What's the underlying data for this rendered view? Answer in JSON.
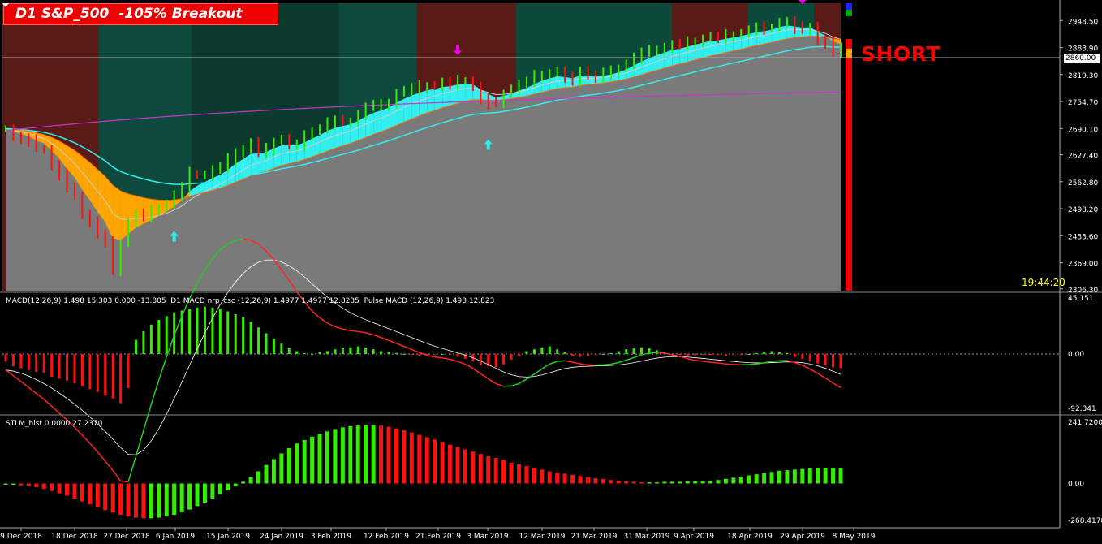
{
  "title": "D1 S&P_500  -105% Breakout",
  "signal": "SHORT",
  "clock": "19:44:20",
  "current_price": "2860.00",
  "macd_label": "MACD(12,26,9) 1.498 15.303 0.000 -13.805  D1 MACD nrp_csc (12,26,9) 1.4977 1.4977 12.8235  Pulse MACD (12,26,9) 1.498 12.823",
  "stlm_label": "STLM_hist 0.0000 27.2370",
  "colors": {
    "up": "#33ee00",
    "down": "#ff1010",
    "cyan": "#33eeee",
    "orange": "#ffa500",
    "magenta": "#ee00ee",
    "gray_fill": "#7a7a7a",
    "bg_green": "#0b4a3a",
    "bg_red": "#5a1a18"
  },
  "chart_data": [
    {
      "type": "bar",
      "name": "price",
      "ylim": [
        2300,
        2990
      ],
      "y_ticks": [
        "2948.50",
        "2883.90",
        "2819.30",
        "2754.70",
        "2690.10",
        "2627.40",
        "2562.80",
        "2498.20",
        "2433.60",
        "2369.00",
        "2306.30"
      ],
      "y_tick_values": [
        2948.5,
        2883.9,
        2819.3,
        2754.7,
        2690.1,
        2627.4,
        2562.8,
        2498.2,
        2433.6,
        2369.0,
        2306.3
      ],
      "x_ticks": [
        "9 Dec 2018",
        "18 Dec 2018",
        "27 Dec 2018",
        "6 Jan 2019",
        "15 Jan 2019",
        "24 Jan 2019",
        "3 Feb 2019",
        "12 Feb 2019",
        "21 Feb 2019",
        "3 Mar 2019",
        "12 Mar 2019",
        "21 Mar 2019",
        "31 Mar 2019",
        "9 Apr 2019",
        "18 Apr 2019",
        "29 Apr 2019",
        "8 May 2019"
      ],
      "closes": [
        2690,
        2670,
        2665,
        2660,
        2642,
        2640,
        2602,
        2580,
        2545,
        2530,
        2485,
        2467,
        2435,
        2416,
        2351,
        2415,
        2465,
        2485,
        2480,
        2490,
        2500,
        2510,
        2530,
        2548,
        2582,
        2580,
        2580,
        2590,
        2595,
        2615,
        2635,
        2640,
        2655,
        2632,
        2640,
        2660,
        2665,
        2650,
        2650,
        2670,
        2685,
        2690,
        2705,
        2707,
        2705,
        2708,
        2725,
        2740,
        2745,
        2745,
        2753,
        2775,
        2780,
        2785,
        2790,
        2793,
        2790,
        2800,
        2795,
        2803,
        2805,
        2790,
        2760,
        2750,
        2749,
        2775,
        2785,
        2795,
        2800,
        2815,
        2820,
        2822,
        2825,
        2810,
        2805,
        2830,
        2815,
        2810,
        2822,
        2825,
        2835,
        2845,
        2860,
        2870,
        2875,
        2880,
        2885,
        2890,
        2888,
        2895,
        2900,
        2905,
        2908,
        2905,
        2912,
        2915,
        2918,
        2925,
        2930,
        2928,
        2933,
        2945,
        2945,
        2930,
        2925,
        2935,
        2900,
        2895,
        2870,
        2880
      ],
      "macd_hist": [
        -8,
        -13,
        -15,
        -17,
        -19,
        -20,
        -24,
        -26,
        -28,
        -31,
        -34,
        -37,
        -40,
        -44,
        -47,
        -52,
        -36,
        15,
        24,
        31,
        36,
        40,
        44,
        46,
        48,
        49,
        50,
        49,
        48,
        45,
        42,
        39,
        34,
        28,
        22,
        16,
        11,
        6,
        3,
        1,
        0,
        2,
        3,
        5,
        6,
        7,
        8,
        7,
        5,
        3,
        2,
        1,
        0,
        -1,
        -2,
        -2,
        -1,
        0,
        -1,
        -3,
        -5,
        -8,
        -12,
        -13,
        -14,
        -11,
        -6,
        -2,
        3,
        5,
        7,
        8,
        5,
        2,
        -2,
        -3,
        -2,
        -1,
        0,
        1,
        3,
        5,
        6,
        7,
        6,
        4,
        2,
        0,
        -1,
        -2,
        -2,
        -1,
        -1,
        -1,
        -2,
        -1,
        -1,
        0,
        1,
        2,
        3,
        2,
        1,
        -3,
        -5,
        -8,
        -10,
        -12,
        -14,
        -15
      ],
      "stlm_hist": [
        -2,
        -2,
        -3,
        -4,
        -6,
        -9,
        -13,
        -17,
        -21,
        -26,
        -31,
        -36,
        -41,
        -46,
        -50,
        -54,
        -57,
        -59,
        -60,
        -60,
        -59,
        -57,
        -54,
        -50,
        -45,
        -39,
        -33,
        -26,
        -19,
        -12,
        -5,
        3,
        11,
        21,
        32,
        42,
        52,
        61,
        69,
        75,
        81,
        86,
        90,
        94,
        97,
        99,
        100,
        101,
        101,
        100,
        98,
        95,
        92,
        88,
        84,
        80,
        76,
        72,
        67,
        63,
        59,
        55,
        51,
        47,
        44,
        40,
        36,
        33,
        30,
        27,
        24,
        21,
        19,
        17,
        15,
        13,
        11,
        9,
        8,
        6,
        5,
        4,
        3,
        2,
        2,
        2,
        3,
        3,
        3,
        4,
        4,
        4,
        5,
        6,
        8,
        10,
        12,
        14,
        16,
        18,
        20,
        22,
        23,
        24,
        25,
        26,
        27,
        27,
        27,
        27
      ],
      "signals": {
        "up_arrows": [
          22,
          63
        ],
        "down_arrows": [
          59,
          104
        ]
      }
    }
  ],
  "macd_axis": {
    "ticks": [
      "45.151",
      "0.00",
      "-92.341"
    ]
  },
  "stlm_axis": {
    "ticks": [
      "241.7200",
      "0.00",
      "-268.4178"
    ]
  }
}
